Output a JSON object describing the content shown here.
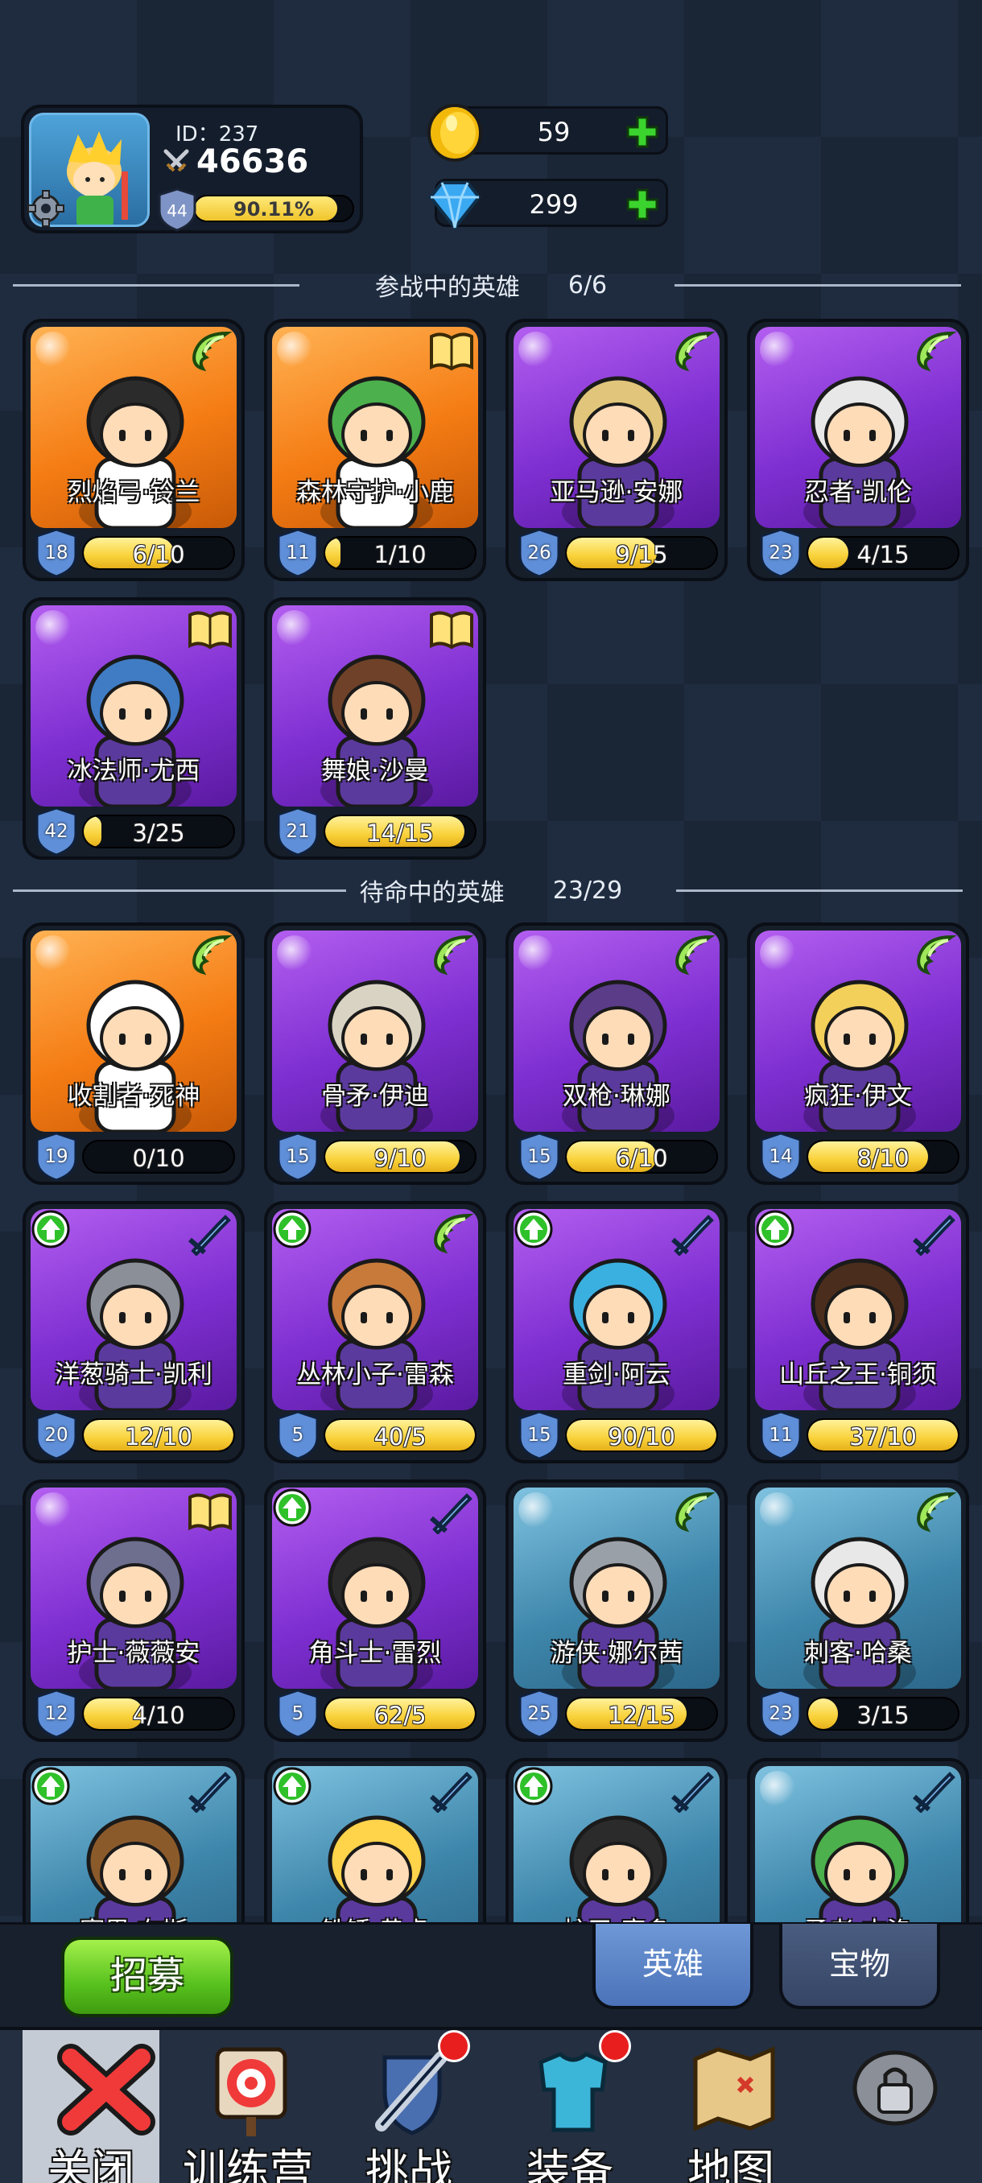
{
  "profile": {
    "id_text": "ID：237",
    "power": "46636",
    "level": "44",
    "xp_percent_text": "90.11%",
    "xp_fraction": 0.9011
  },
  "currencies": {
    "gold": "59",
    "gems": "299"
  },
  "sections": {
    "deployed_title": "参战中的英雄",
    "deployed_count": "6/6",
    "standby_title": "待命中的英雄",
    "standby_count": "23/29"
  },
  "deployed_heroes": [
    {
      "name": "烈焰弓·铃兰",
      "level": "18",
      "progress": "6/10",
      "fill": 0.6,
      "bg": "orange",
      "badge": "wing",
      "up": false
    },
    {
      "name": "森林守护·小鹿",
      "level": "11",
      "progress": "1/10",
      "fill": 0.1,
      "bg": "orange",
      "badge": "book",
      "up": false
    },
    {
      "name": "亚马逊·安娜",
      "level": "26",
      "progress": "9/15",
      "fill": 0.6,
      "bg": "purple",
      "badge": "wing",
      "up": false
    },
    {
      "name": "忍者·凯伦",
      "level": "23",
      "progress": "4/15",
      "fill": 0.27,
      "bg": "purple",
      "badge": "wing",
      "up": false
    },
    {
      "name": "冰法师·尤西",
      "level": "42",
      "progress": "3/25",
      "fill": 0.12,
      "bg": "purple",
      "badge": "book",
      "up": false
    },
    {
      "name": "舞娘·沙曼",
      "level": "21",
      "progress": "14/15",
      "fill": 0.93,
      "bg": "purple",
      "badge": "book",
      "up": false
    }
  ],
  "standby_heroes": [
    {
      "name": "收割者·死神",
      "level": "19",
      "progress": "0/10",
      "fill": 0.0,
      "bg": "orange",
      "badge": "wing",
      "up": false
    },
    {
      "name": "骨矛·伊迪",
      "level": "15",
      "progress": "9/10",
      "fill": 0.9,
      "bg": "purple",
      "badge": "wing",
      "up": false
    },
    {
      "name": "双枪·琳娜",
      "level": "15",
      "progress": "6/10",
      "fill": 0.6,
      "bg": "purple",
      "badge": "wing",
      "up": false
    },
    {
      "name": "疯狂·伊文",
      "level": "14",
      "progress": "8/10",
      "fill": 0.8,
      "bg": "purple",
      "badge": "wing",
      "up": false
    },
    {
      "name": "洋葱骑士·凯利",
      "level": "20",
      "progress": "12/10",
      "fill": 1.0,
      "bg": "purple",
      "badge": "sword",
      "up": true
    },
    {
      "name": "丛林小子·雷森",
      "level": "5",
      "progress": "40/5",
      "fill": 1.0,
      "bg": "purple",
      "badge": "wing",
      "up": true
    },
    {
      "name": "重剑·阿云",
      "level": "15",
      "progress": "90/10",
      "fill": 1.0,
      "bg": "purple",
      "badge": "sword",
      "up": true
    },
    {
      "name": "山丘之王·铜须",
      "level": "11",
      "progress": "37/10",
      "fill": 1.0,
      "bg": "purple",
      "badge": "sword",
      "up": true
    },
    {
      "name": "护士·薇薇安",
      "level": "12",
      "progress": "4/10",
      "fill": 0.4,
      "bg": "purple",
      "badge": "book",
      "up": false
    },
    {
      "name": "角斗士·雷烈",
      "level": "5",
      "progress": "62/5",
      "fill": 1.0,
      "bg": "purple",
      "badge": "sword",
      "up": true
    },
    {
      "name": "游侠·娜尔茜",
      "level": "25",
      "progress": "12/15",
      "fill": 0.8,
      "bg": "blue",
      "badge": "wing",
      "up": false
    },
    {
      "name": "刺客·哈桑",
      "level": "23",
      "progress": "3/15",
      "fill": 0.2,
      "bg": "blue",
      "badge": "wing",
      "up": false
    },
    {
      "name": "赛里·布斯",
      "level": "",
      "progress": "",
      "fill": 0.0,
      "bg": "blue",
      "badge": "sword",
      "up": true
    },
    {
      "name": "铁锤·黄虎",
      "level": "",
      "progress": "",
      "fill": 0.0,
      "bg": "blue",
      "badge": "sword",
      "up": true
    },
    {
      "name": "护卫·摩多",
      "level": "",
      "progress": "",
      "fill": 0.0,
      "bg": "blue",
      "badge": "sword",
      "up": true
    },
    {
      "name": "勇者·杰洛",
      "level": "",
      "progress": "",
      "fill": 0.0,
      "bg": "blue",
      "badge": "sword",
      "up": false
    }
  ],
  "buttons": {
    "recruit": "招募",
    "tab_heroes": "英雄",
    "tab_treasure": "宝物"
  },
  "nav": [
    {
      "label": "关闭",
      "icon": "close-icon"
    },
    {
      "label": "训练营",
      "icon": "target-icon"
    },
    {
      "label": "挑战",
      "icon": "sword-shield-icon",
      "dot": true
    },
    {
      "label": "装备",
      "icon": "armor-icon",
      "dot": true
    },
    {
      "label": "地图",
      "icon": "map-icon"
    },
    {
      "label": "",
      "icon": "locked-icon"
    }
  ]
}
